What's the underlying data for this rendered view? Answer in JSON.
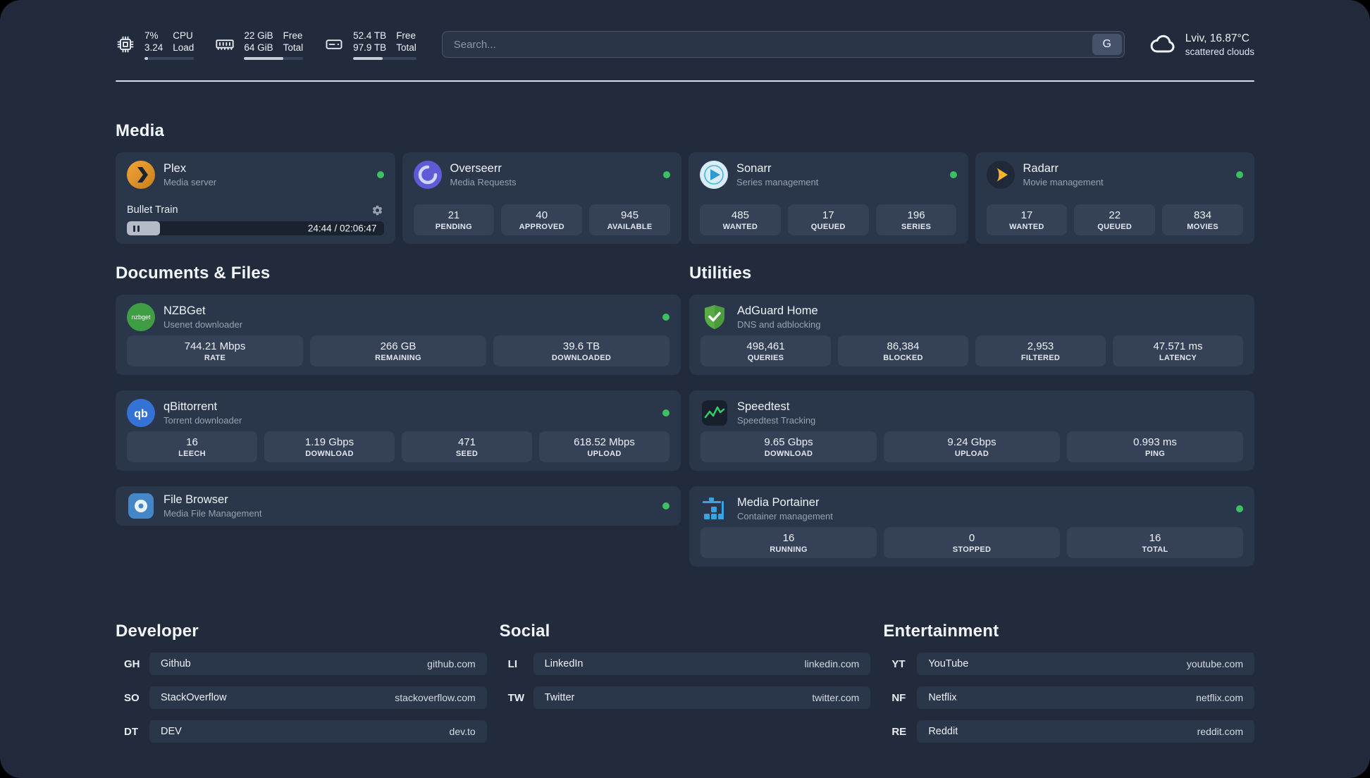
{
  "colors": {
    "background": "#212b3b",
    "card": "#2a3649",
    "tile": "#354156",
    "status_online": "#3cc062",
    "divider": "#d9dee5",
    "accent_text": "#eef2f7",
    "muted_text": "#97a2b4"
  },
  "topbar": {
    "cpu": {
      "value_top": "7%",
      "label_top": "CPU",
      "value_bottom": "3.24",
      "label_bottom": "Load",
      "bar_style": "width:7%"
    },
    "ram": {
      "value_top": "22 GiB",
      "label_top": "Free",
      "value_bottom": "64 GiB",
      "label_bottom": "Total",
      "bar_style": "width:66%"
    },
    "disk": {
      "value_top": "52.4 TB",
      "label_top": "Free",
      "value_bottom": "97.9 TB",
      "label_bottom": "Total",
      "bar_style": "width:47%"
    },
    "search": {
      "placeholder": "Search...",
      "button_label": "G"
    },
    "weather": {
      "location": "Lviv, 16.87°C",
      "condition": "scattered clouds"
    }
  },
  "sections": {
    "media": "Media",
    "documents": "Documents & Files",
    "utilities": "Utilities",
    "developer": "Developer",
    "social": "Social",
    "entertainment": "Entertainment"
  },
  "plex": {
    "name": "Plex",
    "subtitle": "Media server",
    "now_playing": "Bullet Train",
    "time": "24:44 / 02:06:47",
    "progress_style": "width:13%"
  },
  "overseerr": {
    "name": "Overseerr",
    "subtitle": "Media Requests",
    "stats": [
      {
        "value": "21",
        "label": "PENDING"
      },
      {
        "value": "40",
        "label": "APPROVED"
      },
      {
        "value": "945",
        "label": "AVAILABLE"
      }
    ]
  },
  "sonarr": {
    "name": "Sonarr",
    "subtitle": "Series management",
    "stats": [
      {
        "value": "485",
        "label": "WANTED"
      },
      {
        "value": "17",
        "label": "QUEUED"
      },
      {
        "value": "196",
        "label": "SERIES"
      }
    ]
  },
  "radarr": {
    "name": "Radarr",
    "subtitle": "Movie management",
    "stats": [
      {
        "value": "17",
        "label": "WANTED"
      },
      {
        "value": "22",
        "label": "QUEUED"
      },
      {
        "value": "834",
        "label": "MOVIES"
      }
    ]
  },
  "nzbget": {
    "name": "NZBGet",
    "subtitle": "Usenet downloader",
    "stats": [
      {
        "value": "744.21 Mbps",
        "label": "RATE"
      },
      {
        "value": "266 GB",
        "label": "REMAINING"
      },
      {
        "value": "39.6 TB",
        "label": "DOWNLOADED"
      }
    ]
  },
  "qbittorrent": {
    "name": "qBittorrent",
    "subtitle": "Torrent downloader",
    "stats": [
      {
        "value": "16",
        "label": "LEECH"
      },
      {
        "value": "1.19 Gbps",
        "label": "DOWNLOAD"
      },
      {
        "value": "471",
        "label": "SEED"
      },
      {
        "value": "618.52 Mbps",
        "label": "UPLOAD"
      }
    ]
  },
  "filebrowser": {
    "name": "File Browser",
    "subtitle": "Media File Management"
  },
  "adguard": {
    "name": "AdGuard Home",
    "subtitle": "DNS and adblocking",
    "stats": [
      {
        "value": "498,461",
        "label": "QUERIES"
      },
      {
        "value": "86,384",
        "label": "BLOCKED"
      },
      {
        "value": "2,953",
        "label": "FILTERED"
      },
      {
        "value": "47.571 ms",
        "label": "LATENCY"
      }
    ]
  },
  "speedtest": {
    "name": "Speedtest",
    "subtitle": "Speedtest Tracking",
    "stats": [
      {
        "value": "9.65 Gbps",
        "label": "DOWNLOAD"
      },
      {
        "value": "9.24 Gbps",
        "label": "UPLOAD"
      },
      {
        "value": "0.993 ms",
        "label": "PING"
      }
    ]
  },
  "portainer": {
    "name": "Media Portainer",
    "subtitle": "Container management",
    "stats": [
      {
        "value": "16",
        "label": "RUNNING"
      },
      {
        "value": "0",
        "label": "STOPPED"
      },
      {
        "value": "16",
        "label": "TOTAL"
      }
    ]
  },
  "bookmarks": {
    "developer": [
      {
        "abbr": "GH",
        "name": "Github",
        "url": "github.com"
      },
      {
        "abbr": "SO",
        "name": "StackOverflow",
        "url": "stackoverflow.com"
      },
      {
        "abbr": "DT",
        "name": "DEV",
        "url": "dev.to"
      }
    ],
    "social": [
      {
        "abbr": "LI",
        "name": "LinkedIn",
        "url": "linkedin.com"
      },
      {
        "abbr": "TW",
        "name": "Twitter",
        "url": "twitter.com"
      }
    ],
    "entertainment": [
      {
        "abbr": "YT",
        "name": "YouTube",
        "url": "youtube.com"
      },
      {
        "abbr": "NF",
        "name": "Netflix",
        "url": "netflix.com"
      },
      {
        "abbr": "RE",
        "name": "Reddit",
        "url": "reddit.com"
      }
    ]
  }
}
